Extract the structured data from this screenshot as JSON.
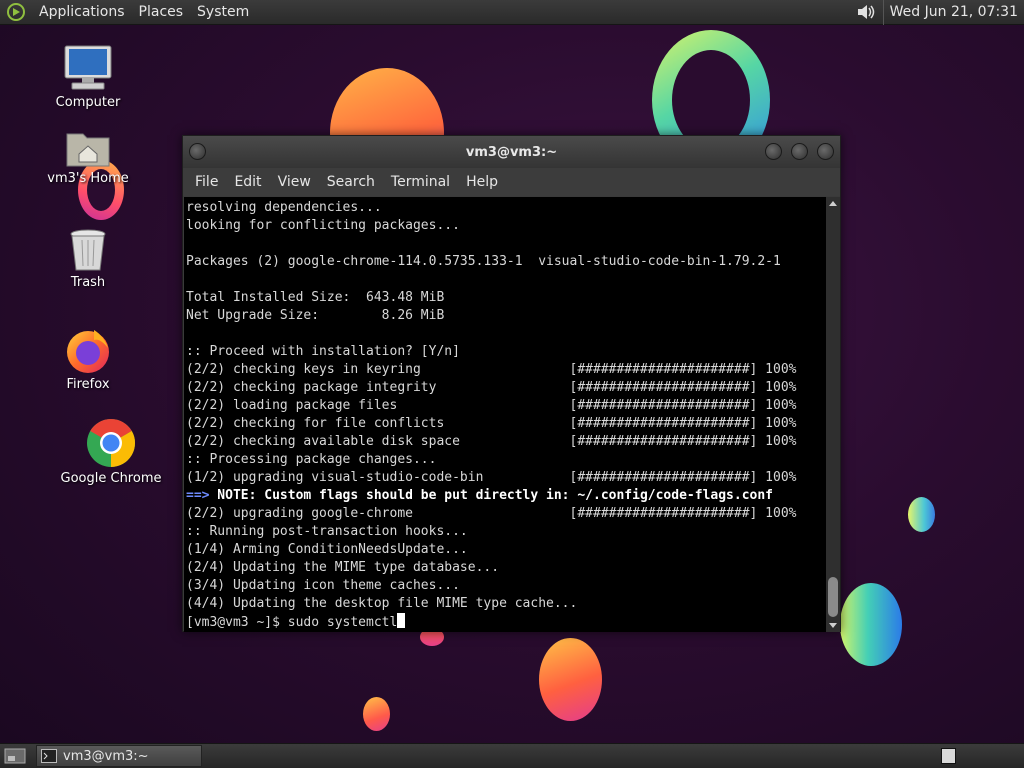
{
  "top_panel": {
    "menus": [
      "Applications",
      "Places",
      "System"
    ],
    "clock": "Wed Jun 21, 07:31"
  },
  "desktop_icons": [
    {
      "label": "Computer",
      "icon": "computer-icon"
    },
    {
      "label": "vm3's Home",
      "icon": "home-folder-icon"
    },
    {
      "label": "Trash",
      "icon": "trash-icon"
    },
    {
      "label": "Firefox",
      "icon": "firefox-icon"
    },
    {
      "label": "Google Chrome",
      "icon": "chrome-icon"
    }
  ],
  "terminal": {
    "title": "vm3@vm3:~",
    "menus": [
      "File",
      "Edit",
      "View",
      "Search",
      "Terminal",
      "Help"
    ],
    "lines": [
      "resolving dependencies...",
      "looking for conflicting packages...",
      "",
      "Packages (2) google-chrome-114.0.5735.133-1  visual-studio-code-bin-1.79.2-1",
      "",
      "Total Installed Size:  643.48 MiB",
      "Net Upgrade Size:        8.26 MiB",
      "",
      ":: Proceed with installation? [Y/n]",
      "(2/2) checking keys in keyring                   [######################] 100%",
      "(2/2) checking package integrity                 [######################] 100%",
      "(2/2) loading package files                      [######################] 100%",
      "(2/2) checking for file conflicts                [######################] 100%",
      "(2/2) checking available disk space              [######################] 100%",
      ":: Processing package changes...",
      "(1/2) upgrading visual-studio-code-bin           [######################] 100%"
    ],
    "note_arrow": "==>",
    "note_text": " NOTE: Custom flags should be put directly in: ~/.config/code-flags.conf",
    "lines_after": [
      "(2/2) upgrading google-chrome                    [######################] 100%",
      ":: Running post-transaction hooks...",
      "(1/4) Arming ConditionNeedsUpdate...",
      "(2/4) Updating the MIME type database...",
      "(3/4) Updating icon theme caches...",
      "(4/4) Updating the desktop file MIME type cache..."
    ],
    "prompt": "[vm3@vm3 ~]$ sudo systemctl"
  },
  "taskbar": {
    "task_label": "vm3@vm3:~"
  }
}
